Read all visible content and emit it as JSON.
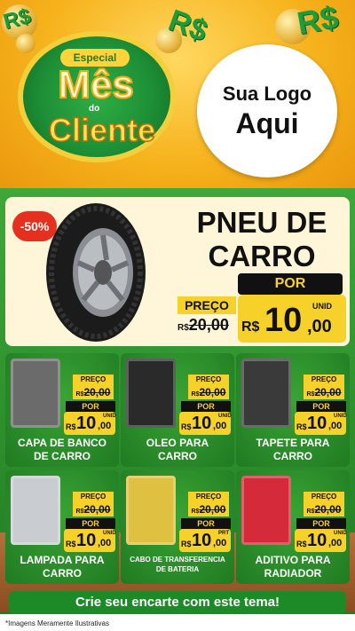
{
  "header": {
    "badge_top": "Especial",
    "badge_main": "Mês",
    "badge_mid": "do",
    "badge_bottom": "Cliente",
    "logo_line1": "Sua Logo",
    "logo_line2": "Aqui",
    "money_symbol": "R$"
  },
  "featured": {
    "discount": "-50%",
    "title_line1": "PNEU DE",
    "title_line2": "CARRO",
    "por": "POR",
    "preco_label": "PREÇO",
    "old_currency": "R$",
    "old_price": "20,00",
    "unid": "UNID",
    "currency": "R$",
    "price_int": "10",
    "price_cents": ",00"
  },
  "products": [
    {
      "name_line1": "CAPA DE BANCO",
      "name_line2": "DE CARRO",
      "preco": "PREÇO",
      "old_currency": "R$",
      "old": "20,00",
      "por": "POR",
      "currency": "R$",
      "int": "10",
      "cents": ",00",
      "unit": "UNID",
      "icon": "seat-cover-icon"
    },
    {
      "name_line1": "OLEO PARA",
      "name_line2": "CARRO",
      "preco": "PREÇO",
      "old_currency": "R$",
      "old": "20,00",
      "por": "POR",
      "currency": "R$",
      "int": "10",
      "cents": ",00",
      "unit": "UNID",
      "icon": "oil-bottle-icon"
    },
    {
      "name_line1": "TAPETE PARA",
      "name_line2": "CARRO",
      "preco": "PREÇO",
      "old_currency": "R$",
      "old": "20,00",
      "por": "POR",
      "currency": "R$",
      "int": "10",
      "cents": ",00",
      "unit": "UNID",
      "icon": "car-mat-icon"
    },
    {
      "name_line1": "LAMPADA PARA",
      "name_line2": "CARRO",
      "preco": "PREÇO",
      "old_currency": "R$",
      "old": "20,00",
      "por": "POR",
      "currency": "R$",
      "int": "10",
      "cents": ",00",
      "unit": "UNID",
      "icon": "headlight-bulb-icon"
    },
    {
      "name_line1": "CABO DE TRANSFERENCIA",
      "name_line2": "DE BATERIA",
      "preco": "PREÇO",
      "old_currency": "R$",
      "old": "20,00",
      "por": "POR",
      "currency": "R$",
      "int": "10",
      "cents": ",00",
      "unit": "PRT",
      "icon": "jumper-cable-icon"
    },
    {
      "name_line1": "ADITIVO PARA",
      "name_line2": "RADIADOR",
      "preco": "PREÇO",
      "old_currency": "R$",
      "old": "20,00",
      "por": "POR",
      "currency": "R$",
      "int": "10",
      "cents": ",00",
      "unit": "UNID",
      "icon": "coolant-bottle-icon"
    }
  ],
  "cta": "Crie seu encarte com este tema!",
  "footnote": "*Imagens Meramente Ilustrativas",
  "colors": {
    "yellow": "#f6d12a",
    "green": "#2f922e",
    "red": "#e53020"
  }
}
